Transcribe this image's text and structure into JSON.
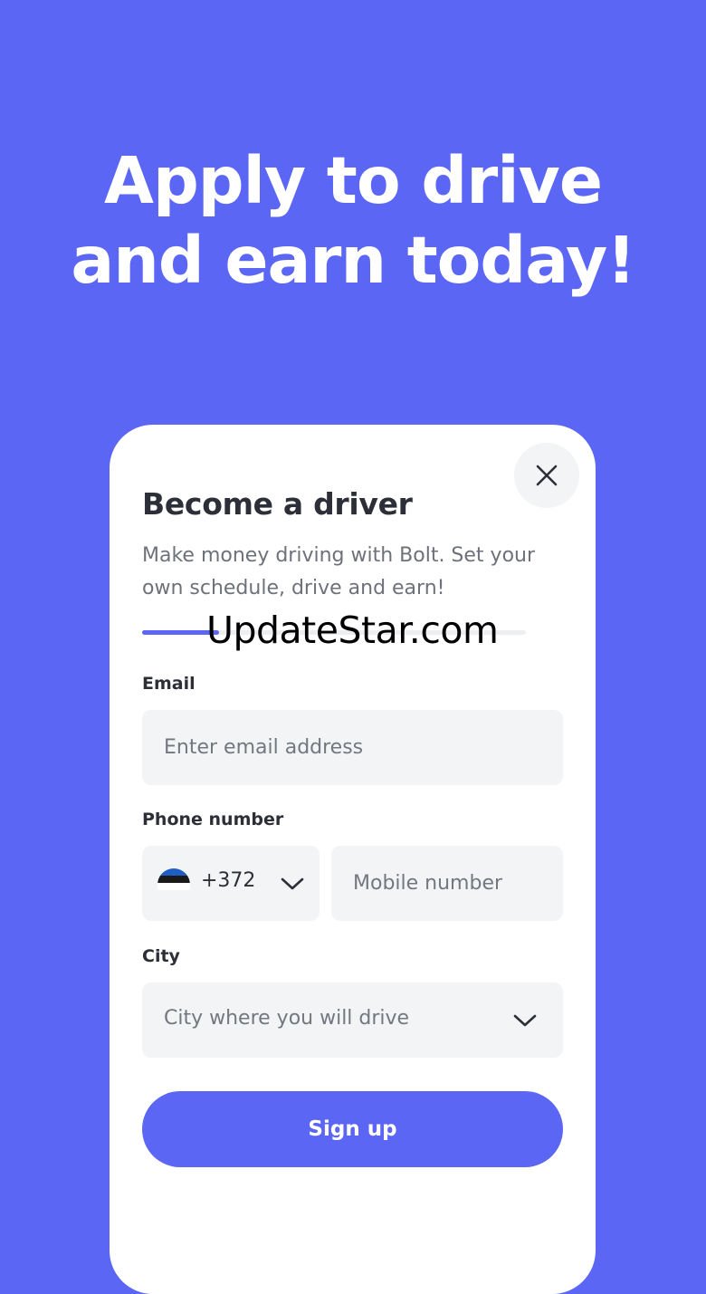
{
  "headline": {
    "line1": "Apply to drive",
    "line2": "and earn today!"
  },
  "form": {
    "title": "Become a driver",
    "subtitle": "Make money driving with Bolt. Set your own schedule, drive and earn!",
    "progress_fraction": 0.2,
    "watermark": "UpdateStar.com",
    "email": {
      "label": "Email",
      "placeholder": "Enter email address",
      "value": ""
    },
    "phone": {
      "label": "Phone number",
      "country_code": "+372",
      "country_flag": "estonia-flag-icon",
      "placeholder": "Mobile number",
      "value": ""
    },
    "city": {
      "label": "City",
      "placeholder": "City where you will drive"
    },
    "submit_label": "Sign up",
    "close_icon": "close-icon"
  },
  "colors": {
    "background": "#5b67f4",
    "accent": "#5b67f4",
    "card": "#ffffff",
    "field": "#f2f4f6",
    "text": "#2c2f37",
    "muted": "#6d717a"
  }
}
